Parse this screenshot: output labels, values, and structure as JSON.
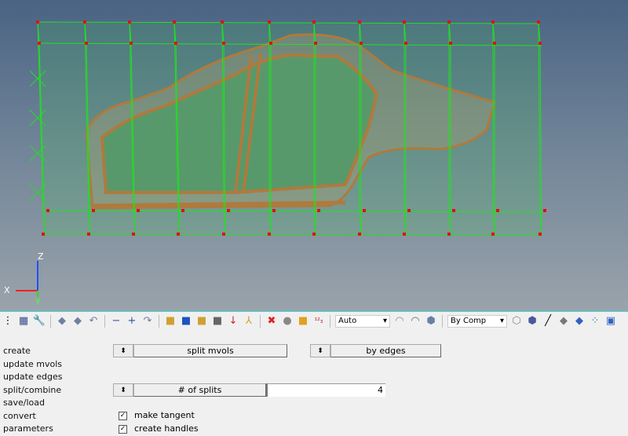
{
  "viewport": {
    "axis": {
      "x": "X",
      "y": "Y",
      "z": "Z"
    },
    "colors": {
      "box_edges": "#22e022",
      "nodes": "#e01010",
      "mesh": "#c06a40",
      "handles": "#e0a070"
    }
  },
  "toolbar": {
    "icons": [
      "menu-dots",
      "window-layout-icon",
      "wrench-icon",
      "rotate-left-icon",
      "rotate-right-icon",
      "undo-view-icon",
      "zoom-out-icon",
      "zoom-in-icon",
      "redo-view-icon",
      "components-icon",
      "assemblies-icon",
      "reference-icon",
      "mask-icon",
      "find-icon",
      "axis-icon",
      "delete-icon",
      "tracking-icon",
      "transfer-icon",
      "numbering-icon"
    ],
    "mesh_mode": "Auto",
    "color_mode": "By Comp"
  },
  "panel": {
    "menu": [
      "create",
      "update mvols",
      "update edges",
      "split/combine",
      "save/load",
      "convert",
      "parameters"
    ],
    "create_type": "split mvols",
    "create_method": "by edges",
    "splits_label": "# of splits",
    "splits_value": "4",
    "make_tangent": {
      "label": "make tangent",
      "checked": true
    },
    "create_handles": {
      "label": "create handles",
      "checked": true
    }
  }
}
